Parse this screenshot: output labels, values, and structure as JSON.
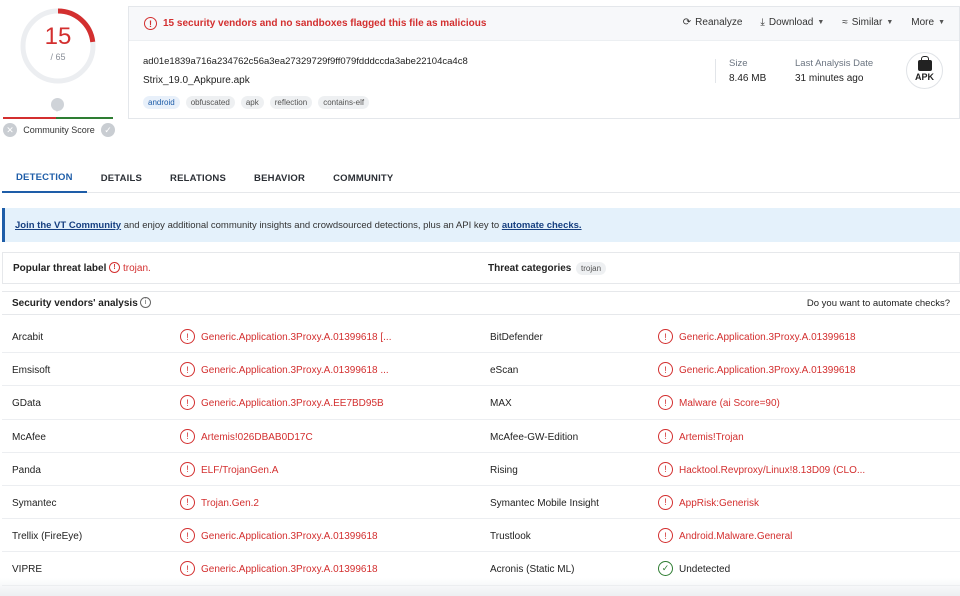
{
  "score": {
    "value": "15",
    "total": "/ 65",
    "ratio": 0.2308,
    "color": "#d32f2f"
  },
  "community": {
    "label": "Community Score"
  },
  "alert": {
    "text": "15 security vendors and no sandboxes flagged this file as malicious"
  },
  "actions": {
    "reanalyze": "Reanalyze",
    "download": "Download",
    "similar": "Similar",
    "more": "More"
  },
  "file": {
    "hash": "ad01e1839a716a234762c56a3ea27329729f9ff079fdddccda3abe22104ca4c8",
    "name": "Strix_19.0_Apkpure.apk",
    "tags": [
      "android",
      "obfuscated",
      "apk",
      "reflection",
      "contains-elf"
    ],
    "size_label": "Size",
    "size_value": "8.46 MB",
    "date_label": "Last Analysis Date",
    "date_value": "31 minutes ago",
    "type_icon_text": "APK"
  },
  "tabs": [
    "DETECTION",
    "DETAILS",
    "RELATIONS",
    "BEHAVIOR",
    "COMMUNITY"
  ],
  "banner": {
    "link1": "Join the VT Community",
    "middle": " and enjoy additional community insights and crowdsourced detections, plus an API key to ",
    "link2": "automate checks."
  },
  "threat": {
    "label_title": "Popular threat label",
    "label_value": "trojan.",
    "categories_title": "Threat categories",
    "category": "trojan"
  },
  "vendors_header": {
    "title": "Security vendors' analysis",
    "automate": "Do you want to automate checks?"
  },
  "vendors": [
    {
      "left_name": "Arcabit",
      "left_result": "Generic.Application.3Proxy.A.01399618 [...",
      "right_name": "BitDefender",
      "right_result": "Generic.Application.3Proxy.A.01399618"
    },
    {
      "left_name": "Emsisoft",
      "left_result": "Generic.Application.3Proxy.A.01399618 ...",
      "right_name": "eScan",
      "right_result": "Generic.Application.3Proxy.A.01399618"
    },
    {
      "left_name": "GData",
      "left_result": "Generic.Application.3Proxy.A.EE7BD95B",
      "right_name": "MAX",
      "right_result": "Malware (ai Score=90)"
    },
    {
      "left_name": "McAfee",
      "left_result": "Artemis!026DBAB0D17C",
      "right_name": "McAfee-GW-Edition",
      "right_result": "Artemis!Trojan"
    },
    {
      "left_name": "Panda",
      "left_result": "ELF/TrojanGen.A",
      "right_name": "Rising",
      "right_result": "Hacktool.Revproxy/Linux!8.13D09 (CLO..."
    },
    {
      "left_name": "Symantec",
      "left_result": "Trojan.Gen.2",
      "right_name": "Symantec Mobile Insight",
      "right_result": "AppRisk:Generisk"
    },
    {
      "left_name": "Trellix (FireEye)",
      "left_result": "Generic.Application.3Proxy.A.01399618",
      "right_name": "Trustlook",
      "right_result": "Android.Malware.General"
    },
    {
      "left_name": "VIPRE",
      "left_result": "Generic.Application.3Proxy.A.01399618",
      "right_name": "Acronis (Static ML)",
      "right_result": "Undetected",
      "right_clean": true
    }
  ]
}
